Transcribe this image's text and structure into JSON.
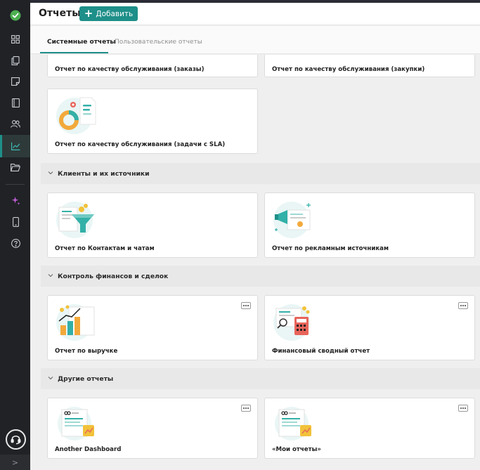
{
  "header": {
    "title": "Отчеты",
    "add_button": "Добавить"
  },
  "tabs": [
    {
      "label": "Системные отчеты",
      "active": true
    },
    {
      "label": "Пользовательские отчеты",
      "active": false
    }
  ],
  "sidebar": {
    "items": [
      "check-logo-icon",
      "grid-icon",
      "copy-icon",
      "note-icon",
      "book-icon",
      "users-icon",
      "chart-icon",
      "folder-icon",
      "sparkle-icon",
      "phone-icon",
      "help-icon",
      "headset-icon"
    ],
    "active": "chart-icon",
    "expand_label": ">"
  },
  "colors": {
    "accent": "#1e8f89",
    "sidebar_bg": "#202226",
    "card_bg": "#ffffff",
    "section_bg": "#e8e8e8"
  },
  "service_quality": {
    "cards": [
      {
        "title": "Отчет по качеству обслуживания (заказы)"
      },
      {
        "title": "Отчет по качеству обслуживания (закупки)"
      },
      {
        "title": "Отчет по качеству обслуживания (задачи с SLA)"
      }
    ]
  },
  "sections": [
    {
      "title": "Клиенты и их источники",
      "cards": [
        {
          "title": "Отчет по Контактам и чатам"
        },
        {
          "title": "Отчет по рекламным источникам"
        }
      ]
    },
    {
      "title": "Контроль финансов и сделок",
      "cards": [
        {
          "title": "Отчет по выручке"
        },
        {
          "title": "Финансовый сводный отчет"
        }
      ]
    },
    {
      "title": "Другие отчеты",
      "cards": [
        {
          "title": "Another Dashboard"
        },
        {
          "title": "«Мои отчеты»"
        }
      ]
    }
  ]
}
